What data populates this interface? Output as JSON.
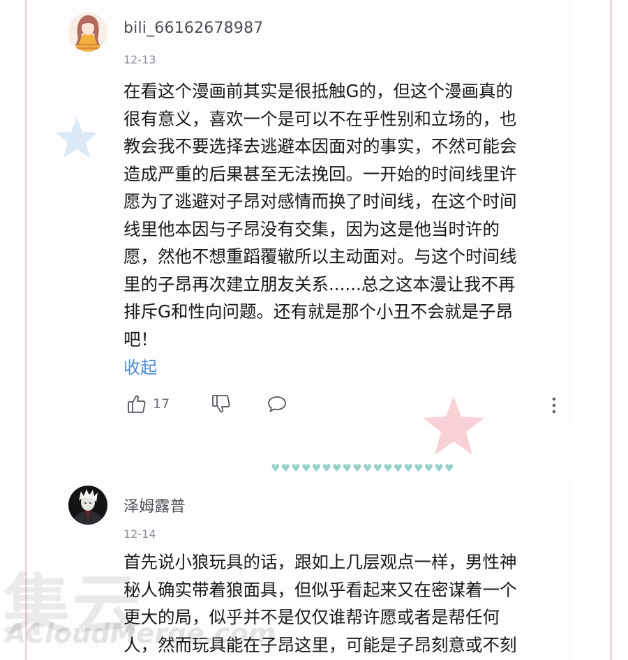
{
  "comments": [
    {
      "username": "bili_66162678987",
      "date": "12-13",
      "text": "在看这个漫画前其实是很抵触G的，但这个漫画真的\n很有意义，喜欢一个是可以不在乎性别和立场的，也\n教会我不要选择去逃避本因面对的事实，不然可能会\n造成严重的后果甚至无法挽回。一开始的时间线里许\n愿为了逃避对子昂对感情而换了时间线，在这个时间\n线里他本因与子昂没有交集，因为这是他当时许的\n愿，然他不想重蹈覆辙所以主动面对。与这个时间线\n里的子昂再次建立朋友关系......总之这本漫让我不再\n排斥G和性向问题。还有就是那个小丑不会就是子昂\n吧！",
      "collapse_label": "收起",
      "like_count": "17",
      "icons": {
        "like": "thumbs-up-icon",
        "dislike": "thumbs-down-icon",
        "reply": "chat-bubble-icon",
        "more": "more-vertical-icon"
      }
    },
    {
      "username": "泽姆露普",
      "date": "12-14",
      "text": "首先说小狼玩具的话，跟如上几层观点一样，男性神\n秘人确实带着狼面具，但似乎看起来又在密谋着一个\n更大的局，似乎并不是仅仅谁帮许愿或者是帮任何\n人，然而玩具能在子昂这里，可能是子昂刻意或不刻"
    }
  ],
  "divider": "♥♥♥♥♥♥♥♥♥♥♥♥♥♥♥♥♥♥",
  "watermark": {
    "cn": "集云",
    "en": "ACloudMerge.com"
  },
  "colors": {
    "link": "#4f8fd6",
    "hearts": "#96d2c9",
    "frame": "#f3d4da",
    "star_pink": "#f7c9cf",
    "star_blue": "#d7e7f5"
  }
}
